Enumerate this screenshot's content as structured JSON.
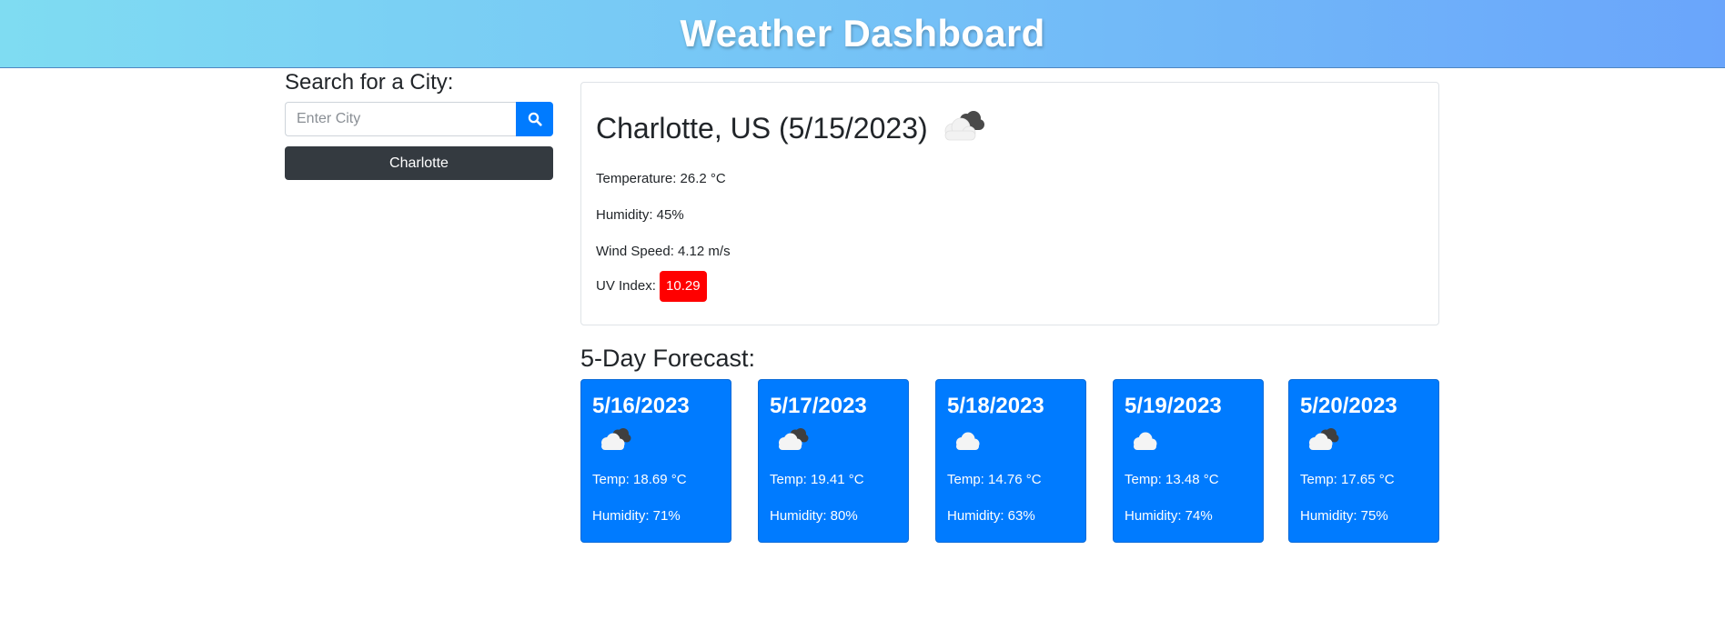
{
  "header": {
    "title": "Weather Dashboard"
  },
  "search": {
    "heading": "Search for a City:",
    "placeholder": "Enter City",
    "value": "",
    "button_icon": "search-icon",
    "history": [
      "Charlotte"
    ]
  },
  "current": {
    "title": "Charlotte, US (5/15/2023)",
    "icon": "cloudy-icon",
    "temperature": "Temperature: 26.2 °C",
    "humidity": "Humidity: 45%",
    "wind": "Wind Speed: 4.12 m/s",
    "uv_label": "UV Index:",
    "uv_value": "10.29",
    "uv_color": "#ff0000"
  },
  "forecast": {
    "heading": "5-Day Forecast:",
    "days": [
      {
        "date": "5/16/2023",
        "icon": "cloudy-icon",
        "temp": "Temp: 18.69 °C",
        "humidity": "Humidity: 71%"
      },
      {
        "date": "5/17/2023",
        "icon": "cloudy-icon",
        "temp": "Temp: 19.41 °C",
        "humidity": "Humidity: 80%"
      },
      {
        "date": "5/18/2023",
        "icon": "cloud-icon",
        "temp": "Temp: 14.76 °C",
        "humidity": "Humidity: 63%"
      },
      {
        "date": "5/19/2023",
        "icon": "cloud-icon",
        "temp": "Temp: 13.48 °C",
        "humidity": "Humidity: 74%"
      },
      {
        "date": "5/20/2023",
        "icon": "cloudy-icon",
        "temp": "Temp: 17.65 °C",
        "humidity": "Humidity: 75%"
      }
    ]
  },
  "colors": {
    "accent": "#007bff",
    "dark_button": "#343a40"
  }
}
